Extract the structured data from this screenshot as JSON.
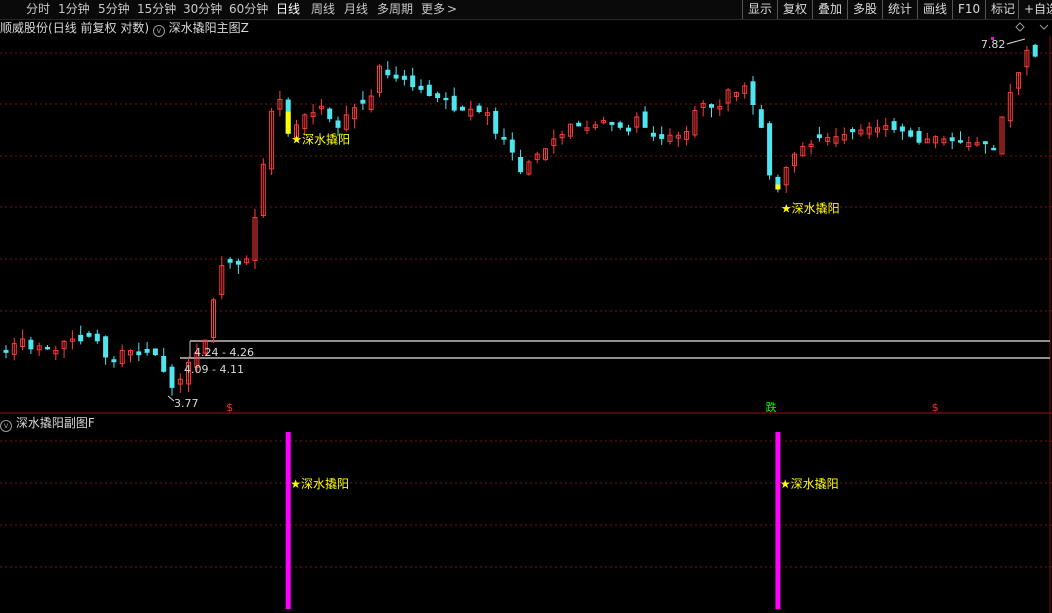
{
  "toolbar": {
    "periods": [
      "分时",
      "1分钟",
      "5分钟",
      "15分钟",
      "30分钟",
      "60分钟",
      "日线",
      "周线",
      "月线",
      "多周期",
      "更多"
    ],
    "active_period": "日线",
    "more_arrow": ">",
    "right_buttons": [
      "显示",
      "复权",
      "叠加",
      "多股",
      "统计",
      "画线",
      "F10",
      "标记",
      "+自选"
    ]
  },
  "stock": {
    "name": "顺威股份",
    "mode": "(日线 前复权 对数)",
    "main_indicator": "深水撬阳主图Z",
    "sub_indicator": "深水撬阳副图F"
  },
  "colors": {
    "up": "#ff3b3b",
    "down": "#4de6ef",
    "signal_bar": "#ffff00",
    "sub_bar": "#ff00ff",
    "star": "#ffff00",
    "grid": "#7a1010",
    "hline": "#c0c0c0"
  },
  "main_chart": {
    "high_label": "7.82",
    "low_label": "3.77",
    "range_upper": "4.24 - 4.26",
    "range_lower": "4.09 - 4.11",
    "signal_label": "★深水撬阳",
    "markers": [
      {
        "day": 27,
        "text": "$",
        "color": "#ff3030"
      },
      {
        "day": 92,
        "text": "跌",
        "color": "#00ff00"
      },
      {
        "day": 112,
        "text": "$",
        "color": "#ff3030"
      }
    ],
    "signal_days": [
      34,
      93
    ],
    "prices": [
      4.14,
      4.22,
      4.26,
      4.17,
      4.2,
      4.17,
      4.16,
      4.24,
      4.26,
      4.24,
      4.28,
      4.24,
      4.1,
      4.06,
      4.16,
      4.16,
      4.12,
      4.14,
      4.12,
      3.98,
      3.85,
      3.92,
      4.06,
      4.14,
      4.25,
      4.62,
      4.96,
      4.99,
      4.97,
      5.03,
      5.48,
      6.12,
      6.83,
      7.0,
      6.52,
      6.64,
      6.78,
      6.81,
      6.9,
      6.72,
      6.6,
      6.78,
      6.88,
      6.94,
      7.05,
      7.5,
      7.36,
      7.31,
      7.29,
      7.18,
      7.14,
      7.05,
      7.02,
      6.99,
      6.84,
      6.84,
      6.86,
      6.82,
      6.81,
      6.52,
      6.44,
      6.27,
      6.02,
      6.15,
      6.25,
      6.32,
      6.45,
      6.51,
      6.65,
      6.62,
      6.6,
      6.64,
      6.7,
      6.64,
      6.6,
      6.55,
      6.75,
      6.6,
      6.48,
      6.45,
      6.5,
      6.5,
      6.55,
      6.84,
      6.94,
      6.88,
      6.9,
      7.14,
      7.1,
      7.2,
      6.92,
      6.6,
      5.98,
      5.82,
      6.08,
      6.25,
      6.35,
      6.38,
      6.46,
      6.47,
      6.48,
      6.51,
      6.54,
      6.57,
      6.61,
      6.6,
      6.63,
      6.57,
      6.55,
      6.48,
      6.4,
      6.45,
      6.48,
      6.45,
      6.42,
      6.4,
      6.4,
      6.4,
      6.38,
      6.3,
      6.75,
      7.1,
      7.4,
      7.75,
      7.65
    ]
  }
}
